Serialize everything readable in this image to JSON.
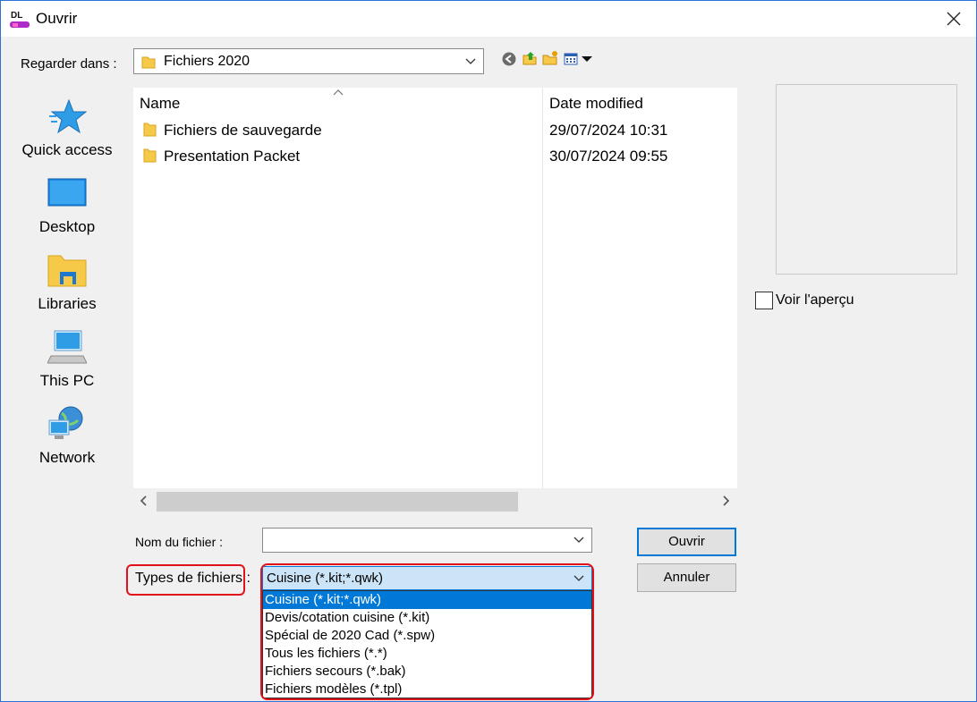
{
  "window": {
    "title": "Ouvrir",
    "app_icon_text": "DL"
  },
  "look_in": {
    "label": "Regarder dans :",
    "value": "Fichiers 2020"
  },
  "toolbar_icons": [
    "back-icon",
    "up-folder-icon",
    "new-folder-icon",
    "view-menu-icon"
  ],
  "places": [
    {
      "label": "Quick access",
      "icon": "star-icon"
    },
    {
      "label": "Desktop",
      "icon": "desktop-icon"
    },
    {
      "label": "Libraries",
      "icon": "libraries-icon"
    },
    {
      "label": "This PC",
      "icon": "computer-icon"
    },
    {
      "label": "Network",
      "icon": "network-icon"
    }
  ],
  "file_list": {
    "columns": [
      "Name",
      "Date modified"
    ],
    "rows": [
      {
        "name": "Fichiers de sauvegarde",
        "date": "29/07/2024 10:31"
      },
      {
        "name": "Presentation Packet",
        "date": "30/07/2024 09:55"
      }
    ]
  },
  "preview": {
    "checkbox_label": "Voir l'aperçu",
    "checked": false
  },
  "filename": {
    "label": "Nom du fichier :",
    "value": ""
  },
  "filetype": {
    "label": "Types de fichiers :",
    "value": "Cuisine (*.kit;*.qwk)",
    "options": [
      "Cuisine (*.kit;*.qwk)",
      "Devis/cotation cuisine (*.kit)",
      "Spécial de 2020 Cad (*.spw)",
      "Tous les fichiers (*.*)",
      "Fichiers secours (*.bak)",
      "Fichiers modèles (*.tpl)"
    ],
    "selected_index": 0
  },
  "buttons": {
    "open": "Ouvrir",
    "cancel": "Annuler"
  },
  "colors": {
    "accent": "#0078d7",
    "highlight_ring": "#e2121b",
    "folder": "#f7c948",
    "window_border": "#2b72d8"
  }
}
